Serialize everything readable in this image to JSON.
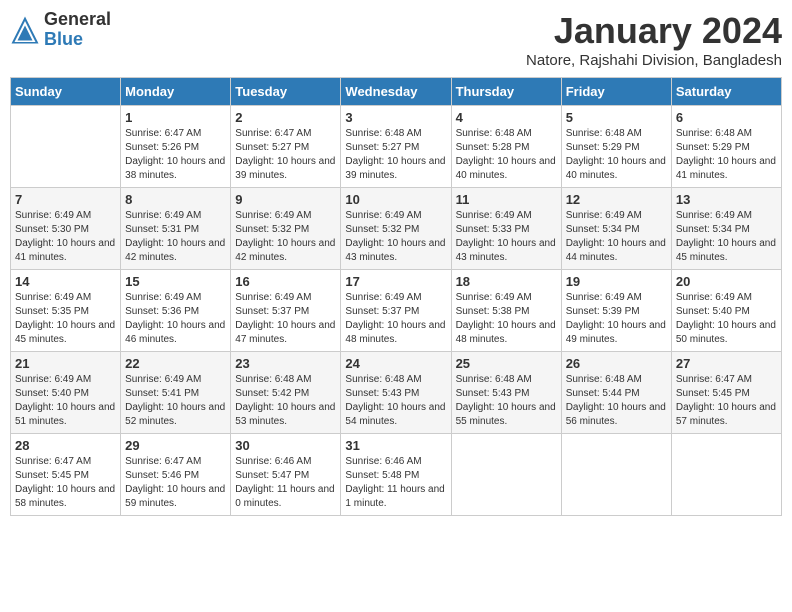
{
  "header": {
    "logo": {
      "general": "General",
      "blue": "Blue"
    },
    "title": "January 2024",
    "subtitle": "Natore, Rajshahi Division, Bangladesh"
  },
  "weekdays": [
    "Sunday",
    "Monday",
    "Tuesday",
    "Wednesday",
    "Thursday",
    "Friday",
    "Saturday"
  ],
  "weeks": [
    [
      {
        "day": "",
        "sunrise": "",
        "sunset": "",
        "daylight": ""
      },
      {
        "day": "1",
        "sunrise": "Sunrise: 6:47 AM",
        "sunset": "Sunset: 5:26 PM",
        "daylight": "Daylight: 10 hours and 38 minutes."
      },
      {
        "day": "2",
        "sunrise": "Sunrise: 6:47 AM",
        "sunset": "Sunset: 5:27 PM",
        "daylight": "Daylight: 10 hours and 39 minutes."
      },
      {
        "day": "3",
        "sunrise": "Sunrise: 6:48 AM",
        "sunset": "Sunset: 5:27 PM",
        "daylight": "Daylight: 10 hours and 39 minutes."
      },
      {
        "day": "4",
        "sunrise": "Sunrise: 6:48 AM",
        "sunset": "Sunset: 5:28 PM",
        "daylight": "Daylight: 10 hours and 40 minutes."
      },
      {
        "day": "5",
        "sunrise": "Sunrise: 6:48 AM",
        "sunset": "Sunset: 5:29 PM",
        "daylight": "Daylight: 10 hours and 40 minutes."
      },
      {
        "day": "6",
        "sunrise": "Sunrise: 6:48 AM",
        "sunset": "Sunset: 5:29 PM",
        "daylight": "Daylight: 10 hours and 41 minutes."
      }
    ],
    [
      {
        "day": "7",
        "sunrise": "Sunrise: 6:49 AM",
        "sunset": "Sunset: 5:30 PM",
        "daylight": "Daylight: 10 hours and 41 minutes."
      },
      {
        "day": "8",
        "sunrise": "Sunrise: 6:49 AM",
        "sunset": "Sunset: 5:31 PM",
        "daylight": "Daylight: 10 hours and 42 minutes."
      },
      {
        "day": "9",
        "sunrise": "Sunrise: 6:49 AM",
        "sunset": "Sunset: 5:32 PM",
        "daylight": "Daylight: 10 hours and 42 minutes."
      },
      {
        "day": "10",
        "sunrise": "Sunrise: 6:49 AM",
        "sunset": "Sunset: 5:32 PM",
        "daylight": "Daylight: 10 hours and 43 minutes."
      },
      {
        "day": "11",
        "sunrise": "Sunrise: 6:49 AM",
        "sunset": "Sunset: 5:33 PM",
        "daylight": "Daylight: 10 hours and 43 minutes."
      },
      {
        "day": "12",
        "sunrise": "Sunrise: 6:49 AM",
        "sunset": "Sunset: 5:34 PM",
        "daylight": "Daylight: 10 hours and 44 minutes."
      },
      {
        "day": "13",
        "sunrise": "Sunrise: 6:49 AM",
        "sunset": "Sunset: 5:34 PM",
        "daylight": "Daylight: 10 hours and 45 minutes."
      }
    ],
    [
      {
        "day": "14",
        "sunrise": "Sunrise: 6:49 AM",
        "sunset": "Sunset: 5:35 PM",
        "daylight": "Daylight: 10 hours and 45 minutes."
      },
      {
        "day": "15",
        "sunrise": "Sunrise: 6:49 AM",
        "sunset": "Sunset: 5:36 PM",
        "daylight": "Daylight: 10 hours and 46 minutes."
      },
      {
        "day": "16",
        "sunrise": "Sunrise: 6:49 AM",
        "sunset": "Sunset: 5:37 PM",
        "daylight": "Daylight: 10 hours and 47 minutes."
      },
      {
        "day": "17",
        "sunrise": "Sunrise: 6:49 AM",
        "sunset": "Sunset: 5:37 PM",
        "daylight": "Daylight: 10 hours and 48 minutes."
      },
      {
        "day": "18",
        "sunrise": "Sunrise: 6:49 AM",
        "sunset": "Sunset: 5:38 PM",
        "daylight": "Daylight: 10 hours and 48 minutes."
      },
      {
        "day": "19",
        "sunrise": "Sunrise: 6:49 AM",
        "sunset": "Sunset: 5:39 PM",
        "daylight": "Daylight: 10 hours and 49 minutes."
      },
      {
        "day": "20",
        "sunrise": "Sunrise: 6:49 AM",
        "sunset": "Sunset: 5:40 PM",
        "daylight": "Daylight: 10 hours and 50 minutes."
      }
    ],
    [
      {
        "day": "21",
        "sunrise": "Sunrise: 6:49 AM",
        "sunset": "Sunset: 5:40 PM",
        "daylight": "Daylight: 10 hours and 51 minutes."
      },
      {
        "day": "22",
        "sunrise": "Sunrise: 6:49 AM",
        "sunset": "Sunset: 5:41 PM",
        "daylight": "Daylight: 10 hours and 52 minutes."
      },
      {
        "day": "23",
        "sunrise": "Sunrise: 6:48 AM",
        "sunset": "Sunset: 5:42 PM",
        "daylight": "Daylight: 10 hours and 53 minutes."
      },
      {
        "day": "24",
        "sunrise": "Sunrise: 6:48 AM",
        "sunset": "Sunset: 5:43 PM",
        "daylight": "Daylight: 10 hours and 54 minutes."
      },
      {
        "day": "25",
        "sunrise": "Sunrise: 6:48 AM",
        "sunset": "Sunset: 5:43 PM",
        "daylight": "Daylight: 10 hours and 55 minutes."
      },
      {
        "day": "26",
        "sunrise": "Sunrise: 6:48 AM",
        "sunset": "Sunset: 5:44 PM",
        "daylight": "Daylight: 10 hours and 56 minutes."
      },
      {
        "day": "27",
        "sunrise": "Sunrise: 6:47 AM",
        "sunset": "Sunset: 5:45 PM",
        "daylight": "Daylight: 10 hours and 57 minutes."
      }
    ],
    [
      {
        "day": "28",
        "sunrise": "Sunrise: 6:47 AM",
        "sunset": "Sunset: 5:45 PM",
        "daylight": "Daylight: 10 hours and 58 minutes."
      },
      {
        "day": "29",
        "sunrise": "Sunrise: 6:47 AM",
        "sunset": "Sunset: 5:46 PM",
        "daylight": "Daylight: 10 hours and 59 minutes."
      },
      {
        "day": "30",
        "sunrise": "Sunrise: 6:46 AM",
        "sunset": "Sunset: 5:47 PM",
        "daylight": "Daylight: 11 hours and 0 minutes."
      },
      {
        "day": "31",
        "sunrise": "Sunrise: 6:46 AM",
        "sunset": "Sunset: 5:48 PM",
        "daylight": "Daylight: 11 hours and 1 minute."
      },
      {
        "day": "",
        "sunrise": "",
        "sunset": "",
        "daylight": ""
      },
      {
        "day": "",
        "sunrise": "",
        "sunset": "",
        "daylight": ""
      },
      {
        "day": "",
        "sunrise": "",
        "sunset": "",
        "daylight": ""
      }
    ]
  ]
}
